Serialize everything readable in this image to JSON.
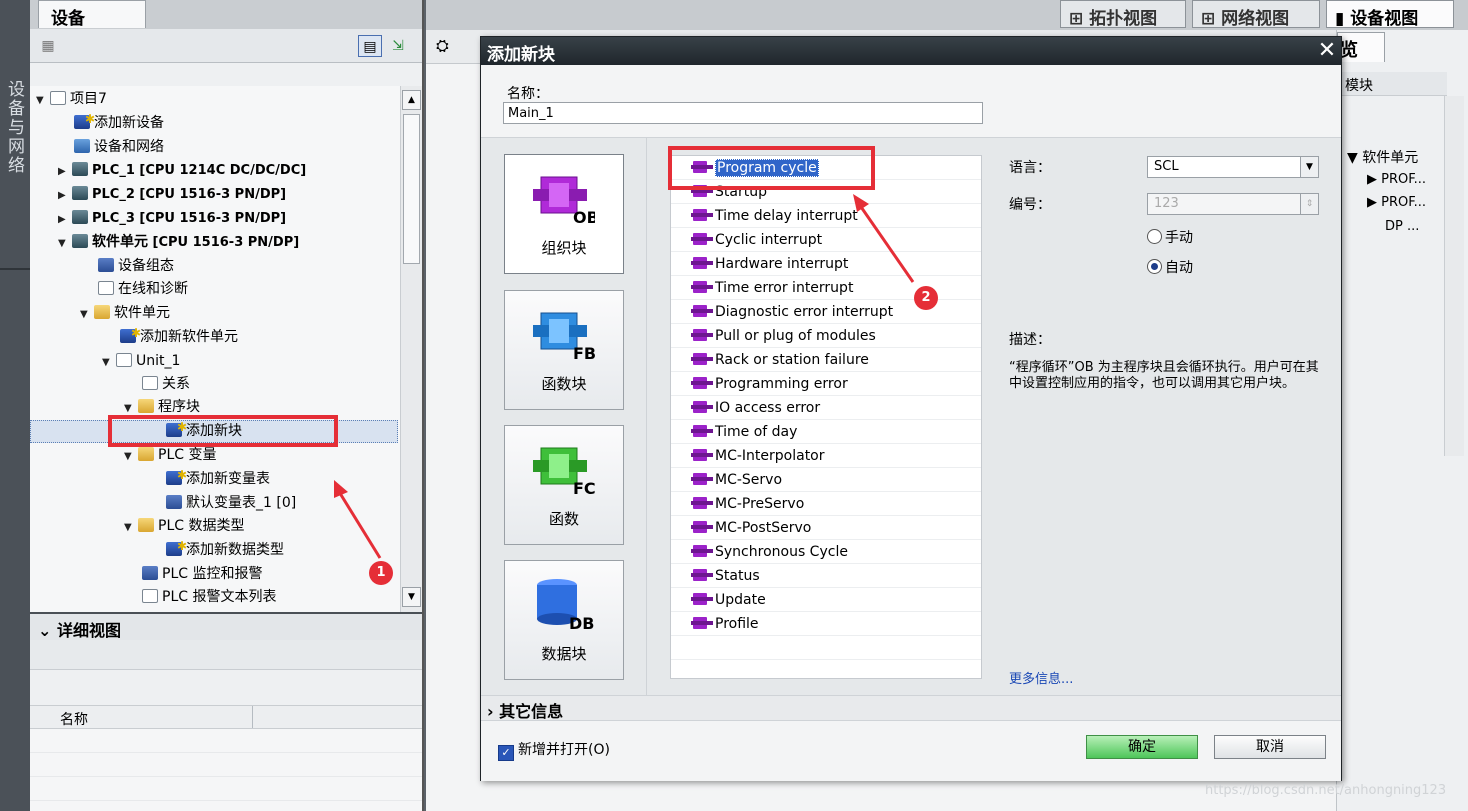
{
  "left_strip": {
    "label": "设备与网络"
  },
  "project_panel": {
    "tab": "设备",
    "tree": [
      {
        "label": "项目7"
      },
      {
        "label": "添加新设备"
      },
      {
        "label": "设备和网络"
      },
      {
        "label": "PLC_1 [CPU 1214C DC/DC/DC]"
      },
      {
        "label": "PLC_2 [CPU 1516-3 PN/DP]"
      },
      {
        "label": "PLC_3 [CPU 1516-3 PN/DP]"
      },
      {
        "label": "软件单元",
        "suffix": " [CPU 1516-3 PN/DP]"
      },
      {
        "label": "设备组态"
      },
      {
        "label": "在线和诊断"
      },
      {
        "label": "软件单元"
      },
      {
        "label": "添加新软件单元"
      },
      {
        "label": "Unit_1"
      },
      {
        "label": "关系"
      },
      {
        "label": "程序块"
      },
      {
        "label": "添加新块"
      },
      {
        "label": "PLC 变量"
      },
      {
        "label": "添加新变量表"
      },
      {
        "label": "默认变量表_1 [0]"
      },
      {
        "label": "PLC 数据类型"
      },
      {
        "label": "添加新数据类型"
      },
      {
        "label": "PLC 监控和报警"
      },
      {
        "label": "PLC 报警文本列表"
      }
    ]
  },
  "detail_view": {
    "title": "详细视图",
    "column_name": "名称"
  },
  "view_tabs": [
    "拓扑视图",
    "网络视图",
    "设备视图"
  ],
  "right_panel": {
    "tab": "览",
    "header": "模块",
    "items": [
      "软件单元",
      "PROF...",
      "PROF...",
      "DP ..."
    ]
  },
  "dialog": {
    "title": "添加新块",
    "name_label": "名称：",
    "name_value": "Main_1",
    "block_types": [
      {
        "code": "OB",
        "label": "组织块",
        "color": "#b02ad8"
      },
      {
        "code": "FB",
        "label": "函数块",
        "color": "#2f8de0"
      },
      {
        "code": "FC",
        "label": "函数",
        "color": "#3fbf3a"
      },
      {
        "code": "DB",
        "label": "数据块",
        "color": "#2f6fe0"
      }
    ],
    "ob_list": [
      "Program cycle",
      "Startup",
      "Time delay interrupt",
      "Cyclic interrupt",
      "Hardware interrupt",
      "Time error interrupt",
      "Diagnostic error interrupt",
      "Pull or plug of modules",
      "Rack or station failure",
      "Programming error",
      "IO access error",
      "Time of day",
      "MC-Interpolator",
      "MC-Servo",
      "MC-PreServo",
      "MC-PostServo",
      "Synchronous Cycle",
      "Status",
      "Update",
      "Profile"
    ],
    "language_label": "语言：",
    "language_value": "SCL",
    "number_label": "编号：",
    "number_value": "123",
    "radio_manual": "手动",
    "radio_auto": "自动",
    "desc_label": "描述：",
    "description": "“程序循环”OB 为主程序块且会循环执行。用户可在其中设置控制应用的指令，也可以调用其它用户块。",
    "more_info": "更多信息...",
    "other_info": "其它信息",
    "checkbox_label": "新增并打开(O)",
    "ok": "确定",
    "cancel": "取消"
  },
  "annotations": {
    "badge1": "1",
    "badge2": "2"
  },
  "watermark": "https://blog.csdn.net/anhongning123"
}
